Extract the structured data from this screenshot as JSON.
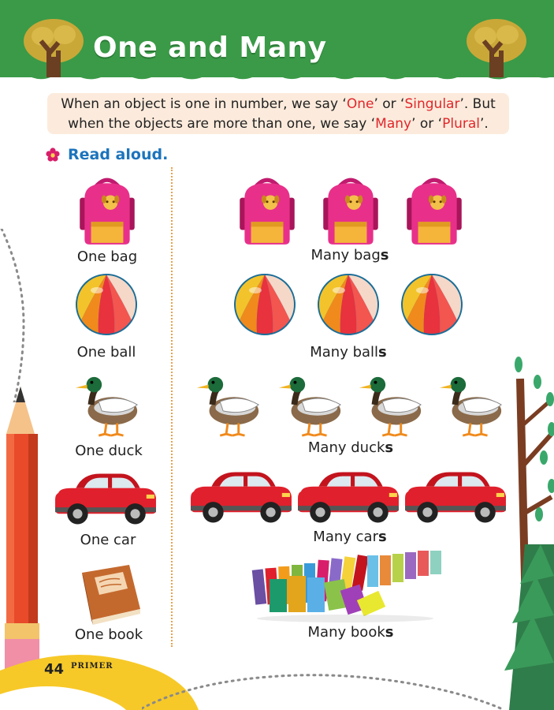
{
  "title": "One and Many",
  "intro": {
    "line1_a": "When an object is one in number, we say ‘",
    "one": "One",
    "line1_b": "’ or ‘",
    "singular": "Singular",
    "line1_c": "’. But",
    "line2_a": "when the objects are more than one, we say ‘",
    "many": "Many",
    "line2_b": "’ or ‘",
    "plural": "Plural",
    "line2_c": "’."
  },
  "instruction": "Read aloud.",
  "rows": [
    {
      "singular": "One bag",
      "plural_stem": "Many bag",
      "plural_suffix": "s"
    },
    {
      "singular": "One ball",
      "plural_stem": "Many ball",
      "plural_suffix": "s"
    },
    {
      "singular": "One duck",
      "plural_stem": "Many duck",
      "plural_suffix": "s"
    },
    {
      "singular": "One car",
      "plural_stem": "Many car",
      "plural_suffix": "s"
    },
    {
      "singular": "One book",
      "plural_stem": "Many book",
      "plural_suffix": "s"
    }
  ],
  "footer": {
    "page_number": "44",
    "series": "PRIMER"
  },
  "colors": {
    "header_green": "#3a9a47",
    "highlight_red": "#e1262b",
    "instruction_blue": "#1c74bc",
    "box_peach": "#fcebdc"
  }
}
